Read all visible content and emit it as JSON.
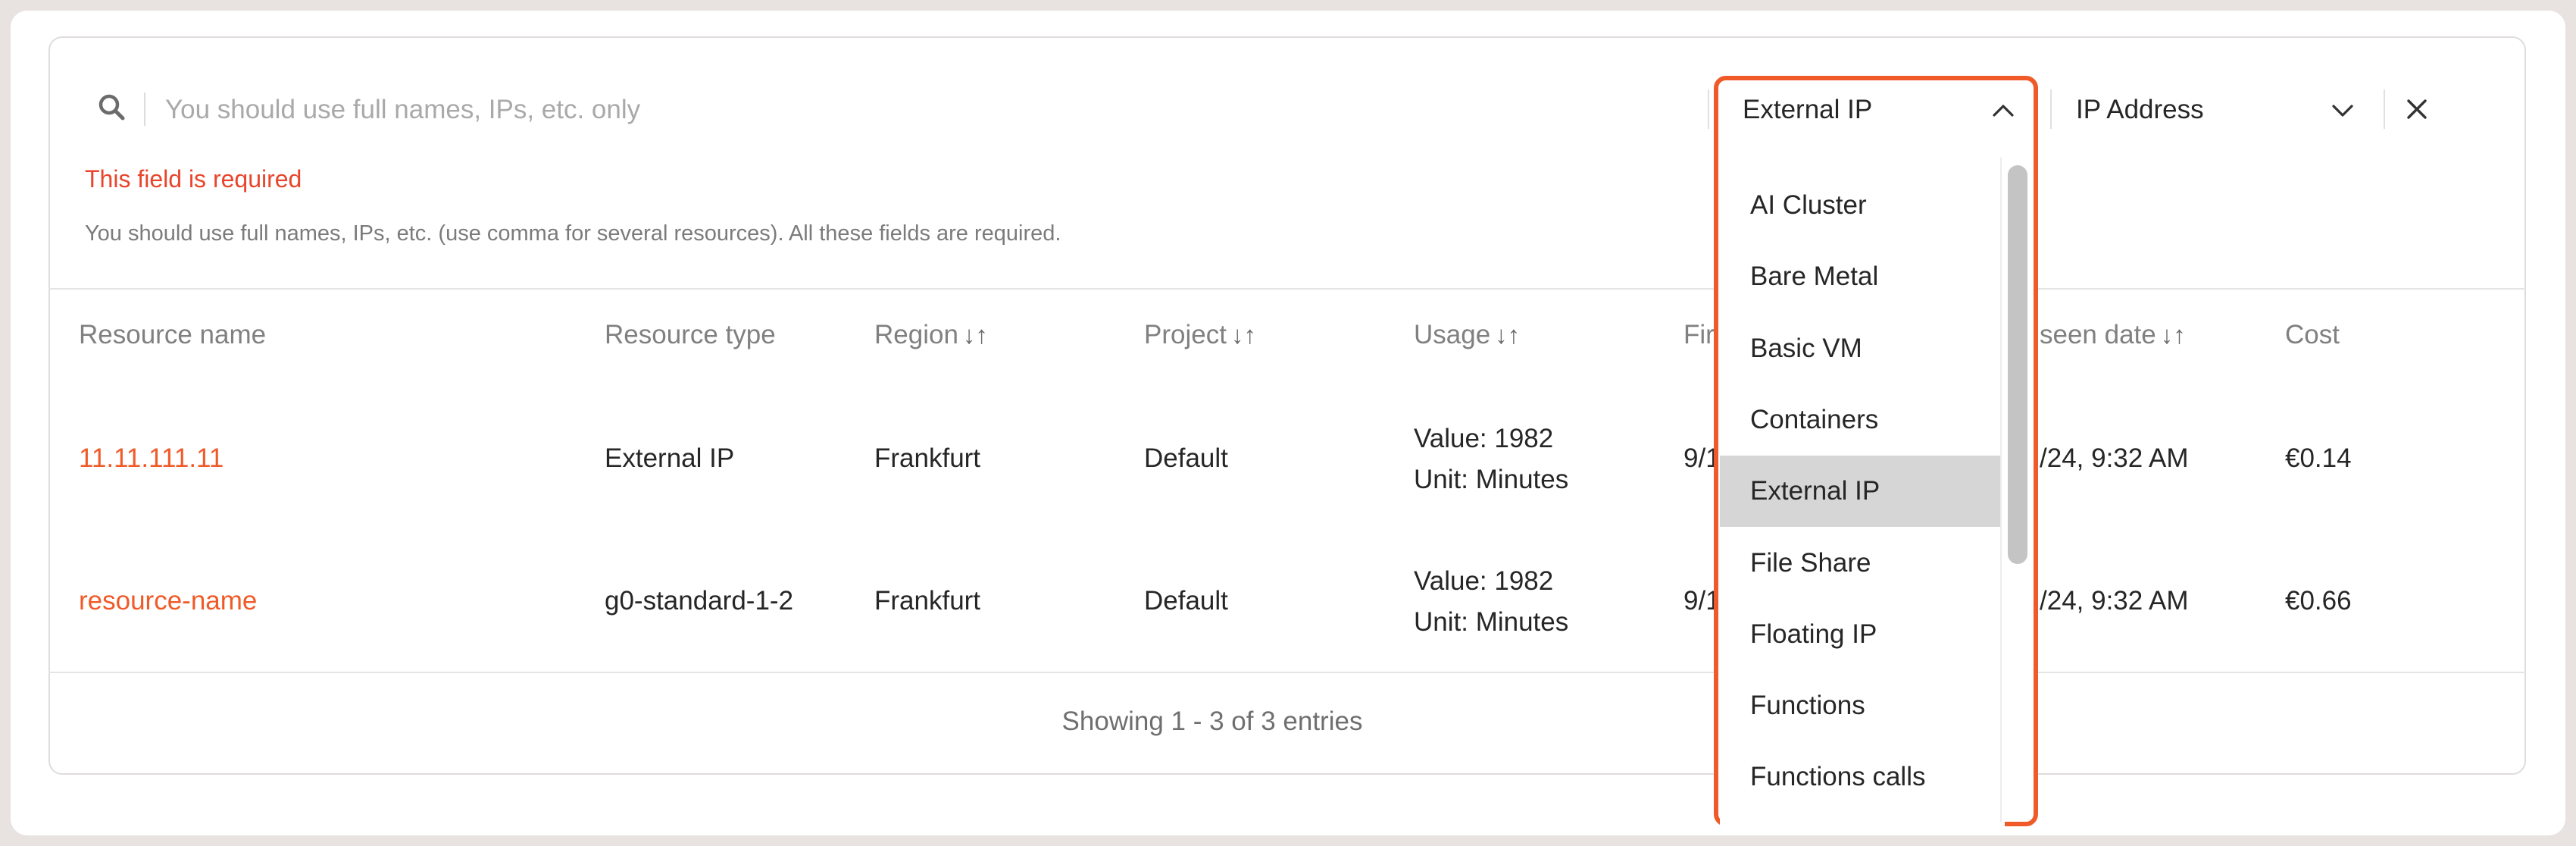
{
  "search": {
    "placeholder": "You should use full names, IPs, etc. only",
    "error": "This field is required",
    "helper": "You should use full names, IPs, etc. (use comma for several resources). All these fields are required."
  },
  "filters": {
    "resource_type_value": "External IP",
    "field_value": "IP Address"
  },
  "table": {
    "headers": {
      "resource_name": "Resource name",
      "resource_type": "Resource type",
      "region": "Region",
      "project": "Project",
      "usage": "Usage",
      "first_seen": "Fir",
      "last_seen": "seen date",
      "cost": "Cost",
      "sort_glyph": "↓↑"
    },
    "rows": [
      {
        "name": "11.11.111.11",
        "type": "External IP",
        "region": "Frankfurt",
        "project": "Default",
        "usage_value": "Value: 1982",
        "usage_unit": "Unit: Minutes",
        "first_seen": "9/1",
        "last_seen": "/24, 9:32 AM",
        "cost": "€0.14"
      },
      {
        "name": "resource-name",
        "type": "g0-standard-1-2",
        "region": "Frankfurt",
        "project": "Default",
        "usage_value": "Value: 1982",
        "usage_unit": "Unit: Minutes",
        "first_seen": "9/1",
        "last_seen": "/24, 9:32 AM",
        "cost": "€0.66"
      }
    ],
    "footer": "Showing 1 - 3 of 3 entries"
  },
  "dropdown": {
    "items": [
      "AI Cluster",
      "Bare Metal",
      "Basic VM",
      "Containers",
      "External IP",
      "File Share",
      "Floating IP",
      "Functions",
      "Functions calls"
    ],
    "selected_index": 4
  },
  "colors": {
    "accent": "#f05a28",
    "error": "#e8452c",
    "selected_bg": "#d6d6d6"
  },
  "icons": {
    "search": "search-icon",
    "chevron_up": "chevron-up-icon",
    "chevron_down": "chevron-down-icon",
    "close": "close-icon"
  }
}
